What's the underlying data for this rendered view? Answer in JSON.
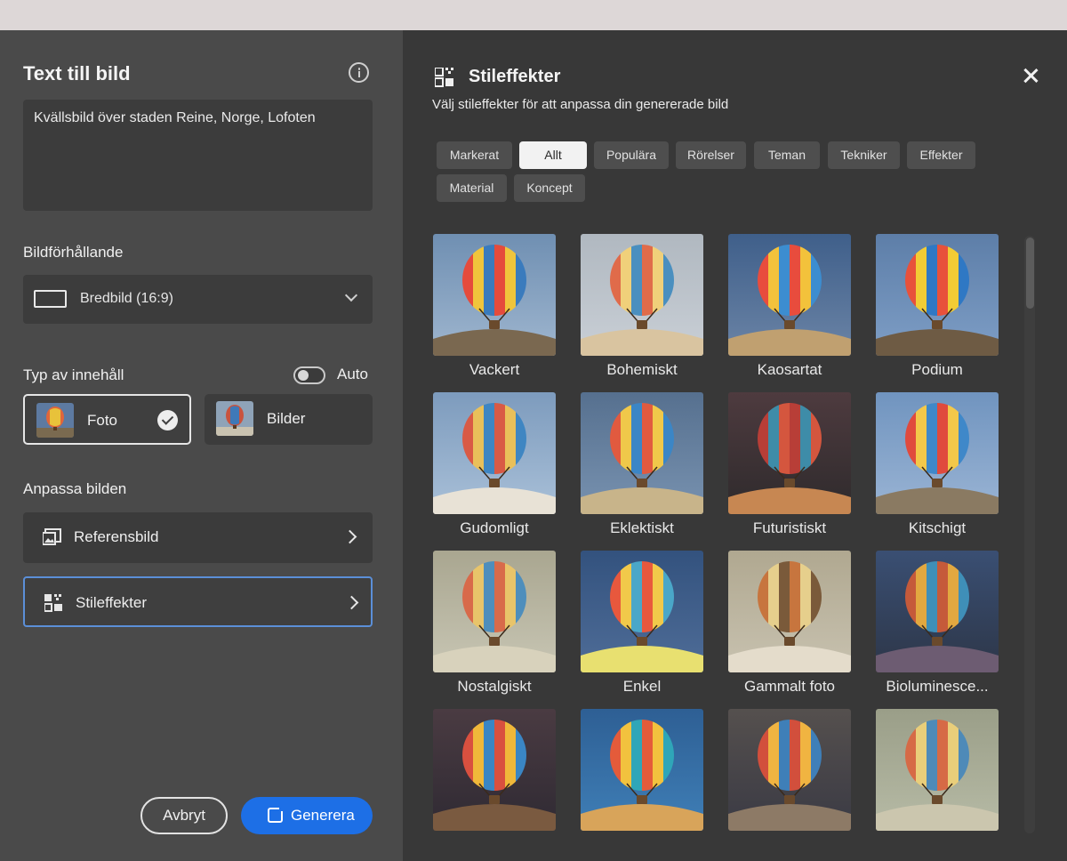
{
  "left_panel": {
    "title": "Text till bild",
    "prompt": "Kvällsbild över staden Reine, Norge, Lofoten",
    "aspect": {
      "label": "Bildförhållande",
      "value": "Bredbild (16:9)"
    },
    "content_type": {
      "label": "Typ av innehåll",
      "toggle_label": "Auto",
      "options": [
        {
          "label": "Foto",
          "selected": true
        },
        {
          "label": "Bilder",
          "selected": false
        }
      ]
    },
    "customize": {
      "label": "Anpassa bilden",
      "rows": [
        {
          "label": "Referensbild"
        },
        {
          "label": "Stileffekter"
        }
      ]
    },
    "buttons": {
      "cancel": "Avbryt",
      "generate": "Generera"
    }
  },
  "right_panel": {
    "title": "Stileffekter",
    "subtitle": "Välj stileffekter för att anpassa din genererade bild",
    "chips": [
      "Markerat",
      "Allt",
      "Populära",
      "Rörelser",
      "Teman",
      "Tekniker",
      "Effekter",
      "Material",
      "Koncept"
    ],
    "selected_chip": "Allt",
    "tiles": [
      "Vackert",
      "Bohemiskt",
      "Kaosartat",
      "Podium",
      "Gudomligt",
      "Eklektiskt",
      "Futuristiskt",
      "Kitschigt",
      "Nostalgiskt",
      "Enkel",
      "Gammalt foto",
      "Bioluminesce...",
      "",
      "",
      "",
      ""
    ]
  },
  "colors": {
    "accent": "#1d6fe6",
    "active_border": "#5b8fd8",
    "left_bg": "#4a4a4a",
    "right_bg": "#383838"
  },
  "icons": [
    "info-icon",
    "aspect-ratio-icon",
    "chevron-down-icon",
    "check-icon",
    "image-reference-icon",
    "style-effects-icon",
    "chevron-right-icon",
    "generate-icon",
    "close-icon"
  ]
}
